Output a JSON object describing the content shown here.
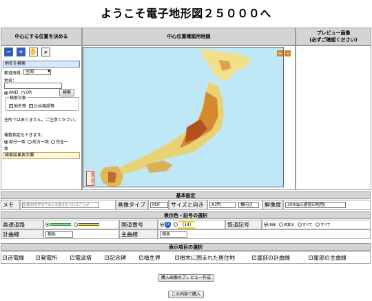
{
  "title": "ようこそ電子地形図２５０００へ",
  "headers": {
    "left": "中心にする位置を決める",
    "center": "中心位置確認用地図",
    "right_line1": "プレビュー画像",
    "right_line2": "(必ずご確認ください)"
  },
  "left_panel": {
    "search_title": "地名を検索",
    "pref_label": "都道府県：",
    "pref_value": "全国",
    "place_label": "地名：",
    "and_label": "AND",
    "or_label": "OR",
    "search_button": "検索",
    "target_label": "検索対象",
    "target_place": "地名等",
    "target_public": "公共施設等",
    "info_text": "住所ではありません。ご注意ください。",
    "match_note": "複数指定もできます。",
    "match_partial": "部分一致",
    "match_prefix": "前方一致",
    "match_exact": "完全一",
    "match_tail": "致",
    "results_label": "検索結果表示欄"
  },
  "map": {
    "zoom_icon_plus": "+",
    "zoom_icon_minus": "−",
    "stamp_text": "電子国土"
  },
  "basic": {
    "section_title": "基本設定",
    "memo_label": "メモ",
    "memo_placeholder": "全角30文字までのメモ書きをつけることが",
    "image_type_label": "画像タイプ",
    "image_type_value": "PDF",
    "size_label": "サイズと向き",
    "size_value": "A3判",
    "orientation_value": "横向き",
    "resolution_label": "解像度",
    "resolution_value": "300dpi(通常印刷用)"
  },
  "colors": {
    "section_title": "表示色・記号の選択",
    "highway_label": "高速道路",
    "national_label": "国道番号",
    "national_sample": "(14)",
    "railway_label": "鉄道記号",
    "railway_opt1": "JR線",
    "railway_opt2": "JR其示",
    "railway_opt3": "すべて",
    "railway_opt4": "すべて",
    "contour_label": "計曲線",
    "contour_value": "褐色",
    "main_contour_label": "主曲線",
    "main_contour_value": "褐色"
  },
  "items": {
    "section_title": "表示項目の選択",
    "list": [
      "送電線",
      "発電所",
      "電波塔",
      "記念碑",
      "植生界",
      "樹木に囲まれた居住地",
      "崖部の計曲線",
      "崖部の主曲線"
    ]
  },
  "buttons": {
    "preview": "購入画像のプレビュー作成",
    "buy": "この内容で購入"
  }
}
